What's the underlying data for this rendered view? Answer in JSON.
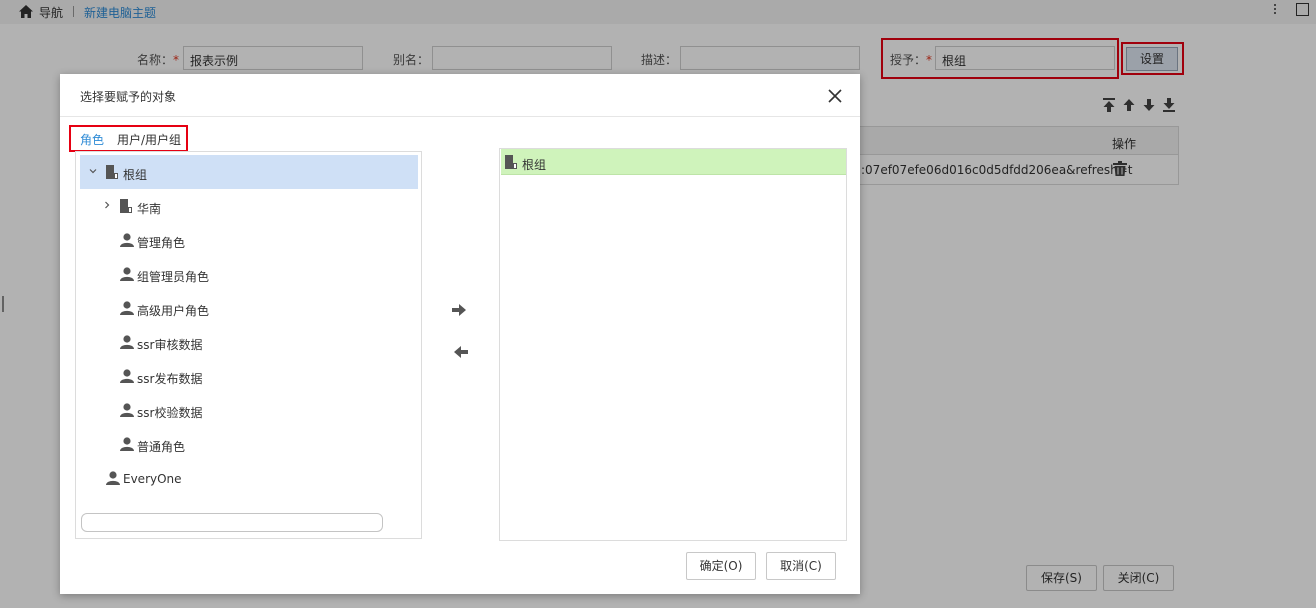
{
  "topbar": {
    "nav_label": "导航",
    "breadcrumb": "新建电脑主题"
  },
  "form": {
    "name_label": "名称：",
    "name_value": "报表示例",
    "alias_label": "别名：",
    "alias_value": "",
    "desc_label": "描述：",
    "desc_value": "",
    "grant_label": "授予：",
    "grant_value": "根组",
    "required_mark": "*",
    "set_button": "设置"
  },
  "table": {
    "op_header": "操作",
    "url_cell": ":07ef07efe06d016c0d5dfdd206ea&refresh=t"
  },
  "page_buttons": {
    "save": "保存(S)",
    "close": "关闭(C)"
  },
  "dialog": {
    "title": "选择要赋予的对象",
    "tab_roles": "角色",
    "tab_users": "用户/用户组",
    "tree": [
      {
        "label": "根组",
        "type": "org",
        "expanded": true,
        "selected": true
      },
      {
        "label": "华南",
        "type": "org",
        "expanded": false
      },
      {
        "label": "管理角色",
        "type": "role"
      },
      {
        "label": "组管理员角色",
        "type": "role"
      },
      {
        "label": "高级用户角色",
        "type": "role"
      },
      {
        "label": "ssr审核数据",
        "type": "role"
      },
      {
        "label": "ssr发布数据",
        "type": "role"
      },
      {
        "label": "ssr校验数据",
        "type": "role"
      },
      {
        "label": "普通角色",
        "type": "role"
      },
      {
        "label": "EveryOne",
        "type": "role"
      }
    ],
    "search_value": "",
    "selected_items": [
      {
        "label": "根组",
        "type": "org"
      }
    ],
    "ok_button": "确定(O)",
    "cancel_button": "取消(C)"
  },
  "colors": {
    "accent": "#2e8bd6",
    "highlight_box": "#e60012",
    "selected_row": "#cfe0f6",
    "chosen_row": "#cff3bb"
  }
}
